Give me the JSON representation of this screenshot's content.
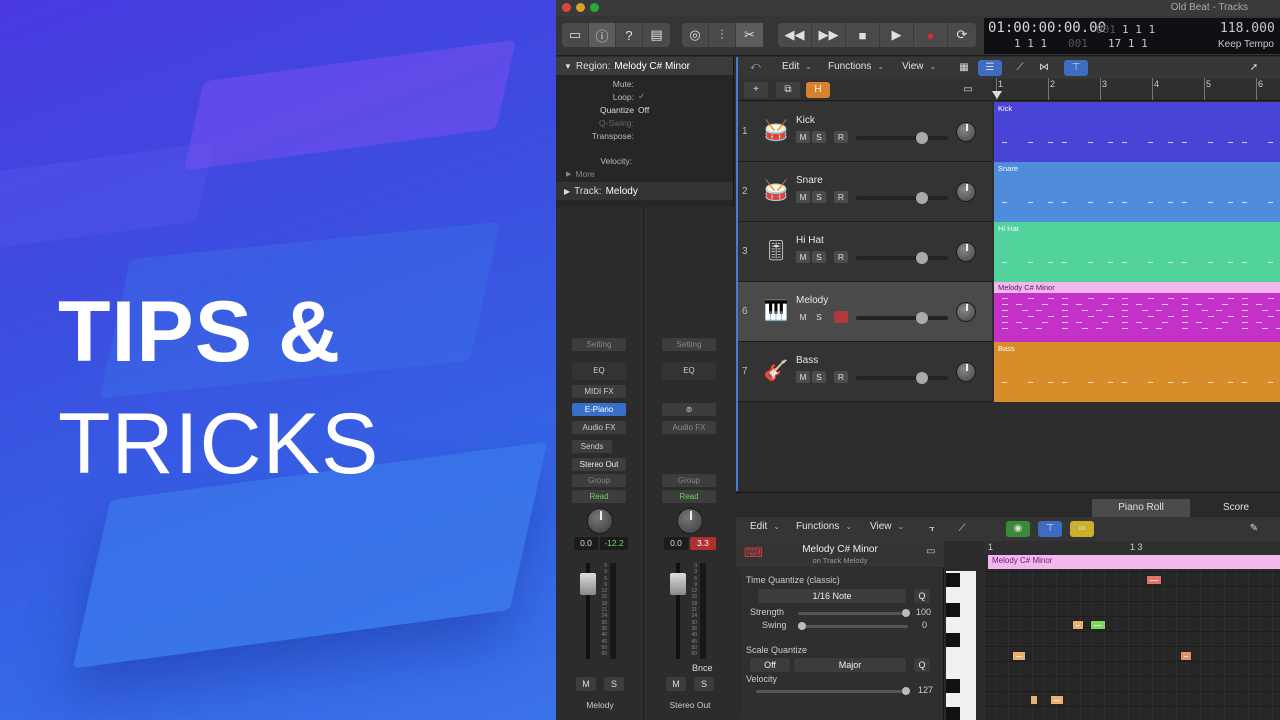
{
  "promo": {
    "line1": "TIPS &",
    "line2": "TRICKS"
  },
  "window": {
    "title": "Old Beat - Tracks"
  },
  "lcd": {
    "timecode": "01:00:00:00.00",
    "bars_top": "1  1  1",
    "bars_top_dim": "001",
    "bars_bottom": "1  1  1",
    "bars_bottom_dim": "001",
    "right_top": "1  1  1",
    "right_bottom": "17  1  1",
    "tempo": "118.000",
    "tempo_mode": "Keep Tempo"
  },
  "inspector": {
    "region_label": "Region:",
    "region_name": "Melody C# Minor",
    "rows": [
      {
        "label": "Mute:",
        "value": ""
      },
      {
        "label": "Loop:",
        "value": "✓"
      },
      {
        "label": "Quantize",
        "value": "Off"
      },
      {
        "label": "Q-Swing:",
        "value": ""
      },
      {
        "label": "Transpose:",
        "value": ""
      },
      {
        "label": "Velocity:",
        "value": ""
      }
    ],
    "more": "More",
    "track_label": "Track:",
    "track_name": "Melody"
  },
  "strips": [
    {
      "setting": "Setting",
      "eq": "EQ",
      "midi_fx": "MIDI FX",
      "instrument": "E-Piano",
      "audio_fx": "Audio FX",
      "sends": "Sends",
      "output": "Stereo Out",
      "group": "Group",
      "automation": "Read",
      "val_left": "0.0",
      "val_right": "-12.2",
      "mute": "M",
      "solo": "S",
      "name": "Melody"
    },
    {
      "setting": "Setting",
      "eq": "EQ",
      "instrument": "",
      "audio_fx": "Audio FX",
      "group": "Group",
      "automation": "Read",
      "val_left": "0.0",
      "val_right": "3.3",
      "bounce": "Bnce",
      "mute": "M",
      "solo": "S",
      "name": "Stereo Out"
    }
  ],
  "fader_scale": [
    "0",
    "3",
    "6",
    "9",
    "12",
    "15",
    "18",
    "21",
    "24",
    "30",
    "35",
    "40",
    "45",
    "50",
    "60"
  ],
  "tracks_toolbar": {
    "edit": "Edit",
    "functions": "Functions",
    "view": "View"
  },
  "ruler": [
    "1",
    "2",
    "3",
    "4",
    "5",
    "6"
  ],
  "tracks": [
    {
      "num": "1",
      "name": "Kick",
      "icon": "kick-drum",
      "color": "#4a44d6",
      "region": "Kick"
    },
    {
      "num": "2",
      "name": "Snare",
      "icon": "snare-drum",
      "color": "#4f8cdc",
      "region": "Snare"
    },
    {
      "num": "3",
      "name": "Hi Hat",
      "icon": "hi-hat",
      "color": "#52d39c",
      "region": "Hi Hat"
    },
    {
      "num": "6",
      "name": "Melody",
      "icon": "keyboard",
      "color": "#c331c8",
      "region": "Melody C# Minor"
    },
    {
      "num": "7",
      "name": "Bass",
      "icon": "bass-guitar",
      "color": "#d98d2a",
      "region": "Bass"
    }
  ],
  "track_buttons": {
    "mute": "M",
    "solo": "S",
    "record": "R"
  },
  "editor": {
    "tab_piano_roll": "Piano Roll",
    "tab_score": "Score",
    "edit": "Edit",
    "functions": "Functions",
    "view": "View",
    "region_name": "Melody C# Minor",
    "region_sub": "on Track Melody",
    "ruler_1": "1",
    "ruler_2": "1 3",
    "time_quantize_label": "Time Quantize (classic)",
    "time_quantize_value": "1/16 Note",
    "q_label": "Q",
    "strength_label": "Strength",
    "strength_value": "100",
    "swing_label": "Swing",
    "swing_value": "0",
    "scale_quantize_label": "Scale Quantize",
    "scale_off": "Off",
    "scale_major": "Major",
    "velocity_label": "Velocity",
    "velocity_value": "127"
  }
}
